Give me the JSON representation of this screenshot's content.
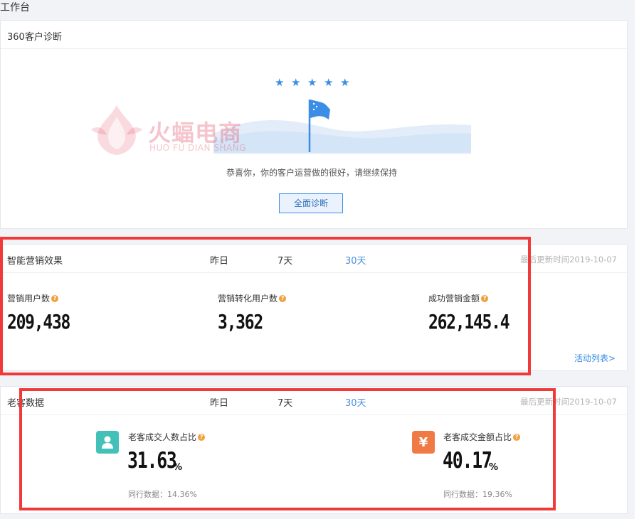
{
  "page": {
    "title": "工作台"
  },
  "diagnose": {
    "title": "360客户诊断",
    "stars": 5,
    "watermark_cn": "火蝠电商",
    "watermark_en": "HUO FU DIAN SHANG",
    "message": "恭喜你，你的客户运营做的很好，请继续保持",
    "button_label": "全面诊断"
  },
  "marketing": {
    "title": "智能营销效果",
    "tabs": [
      "昨日",
      "7天",
      "30天"
    ],
    "active_tab": "30天",
    "updated": "最后更新时间2019-10-07",
    "metrics": [
      {
        "label": "营销用户数",
        "value": "209,438"
      },
      {
        "label": "营销转化用户数",
        "value": "3,362"
      },
      {
        "label": "成功营销金额",
        "value": "262,145.4"
      }
    ],
    "link_label": "活动列表>"
  },
  "old_customers": {
    "title": "老客数据",
    "tabs": [
      "昨日",
      "7天",
      "30天"
    ],
    "active_tab": "30天",
    "updated": "最后更新时间2019-10-07",
    "kpis": [
      {
        "label": "老客成交人数占比",
        "value": "31.63",
        "unit": "%",
        "benchmark": "同行数据：14.36%",
        "icon": "user-icon"
      },
      {
        "label": "老客成交金额占比",
        "value": "40.17",
        "unit": "%",
        "benchmark": "同行数据：19.36%",
        "icon": "yuan-icon",
        "icon_glyph": "¥"
      }
    ]
  },
  "colors": {
    "accent": "#3a8ee6",
    "highlight": "#f03a3a",
    "teal": "#43c0b8",
    "orange": "#ef7a45"
  }
}
